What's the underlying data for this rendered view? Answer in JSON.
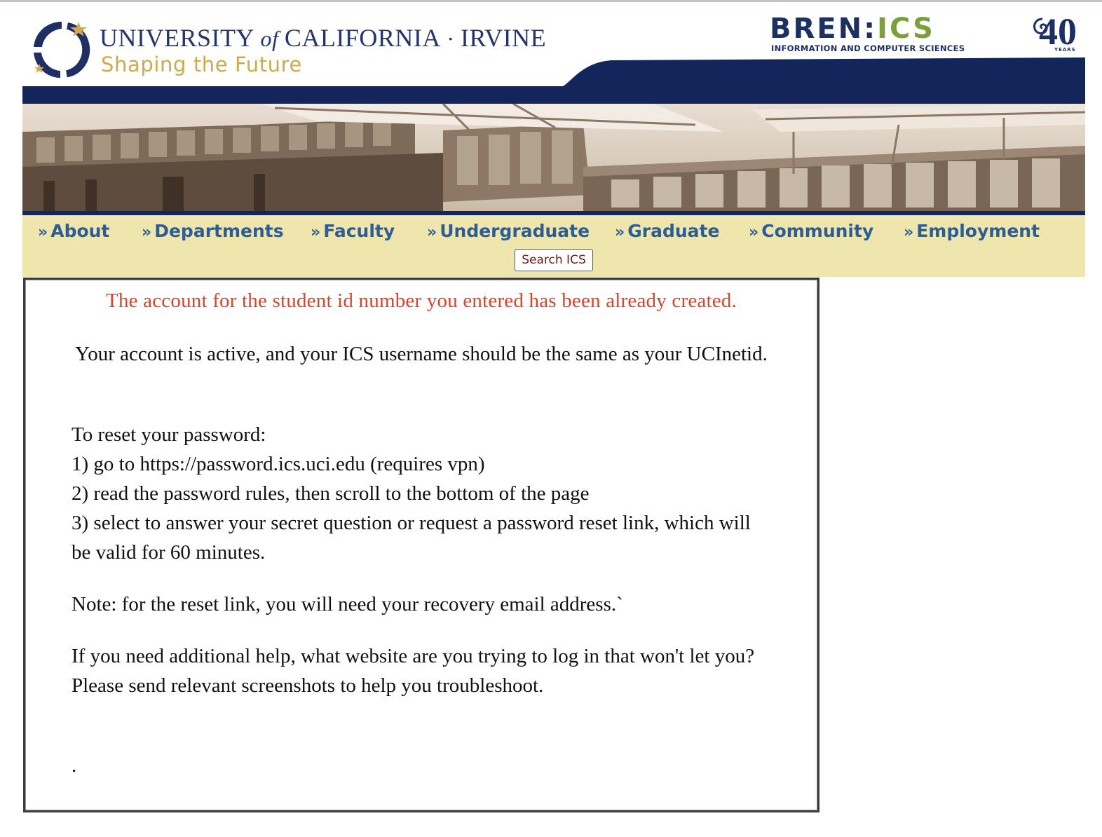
{
  "header": {
    "uci_title_university": "UNIVERSITY",
    "uci_title_of": "of",
    "uci_title_california": "CALIFORNIA",
    "uci_title_sep": "·",
    "uci_title_irvine": "IRVINE",
    "tagline": "Shaping the Future",
    "bren_word": "BREN:",
    "bren_ics": "ICS",
    "bren_sub": "INFORMATION AND COMPUTER SCIENCES",
    "anniversary_number": "40",
    "anniversary_label": "YEARS"
  },
  "nav": {
    "items": [
      {
        "label": "About"
      },
      {
        "label": "Departments"
      },
      {
        "label": "Faculty"
      },
      {
        "label": "Undergraduate"
      },
      {
        "label": "Graduate"
      },
      {
        "label": "Community"
      },
      {
        "label": "Employment"
      }
    ],
    "bullet": "»",
    "search_label": "Search ICS"
  },
  "message": {
    "error": "The account for the student id number you entered has been already created.",
    "active": "Your account is active, and your ICS username should be the same as your UCInetid.",
    "reset_heading": "To reset your password:",
    "step1": "1) go to https://password.ics.uci.edu (requires vpn)",
    "step2": "2) read the password rules, then scroll to the bottom of the page",
    "step3": "3) select to answer your secret question or request a password reset link, which will be valid for 60 minutes.",
    "note": "Note: for the reset link, you will need your recovery email address.`",
    "help": "If you need additional help, what website are you trying to log in that won't let you? Please send relevant screenshots to help you troubleshoot.",
    "trailing_dot": "."
  },
  "colors": {
    "navy": "#13265c",
    "gold": "#cdaa4d",
    "nav_bg": "#efe6ad",
    "nav_text": "#2d5d97",
    "error_red": "#d9442b",
    "ics_green": "#7aa03a"
  }
}
